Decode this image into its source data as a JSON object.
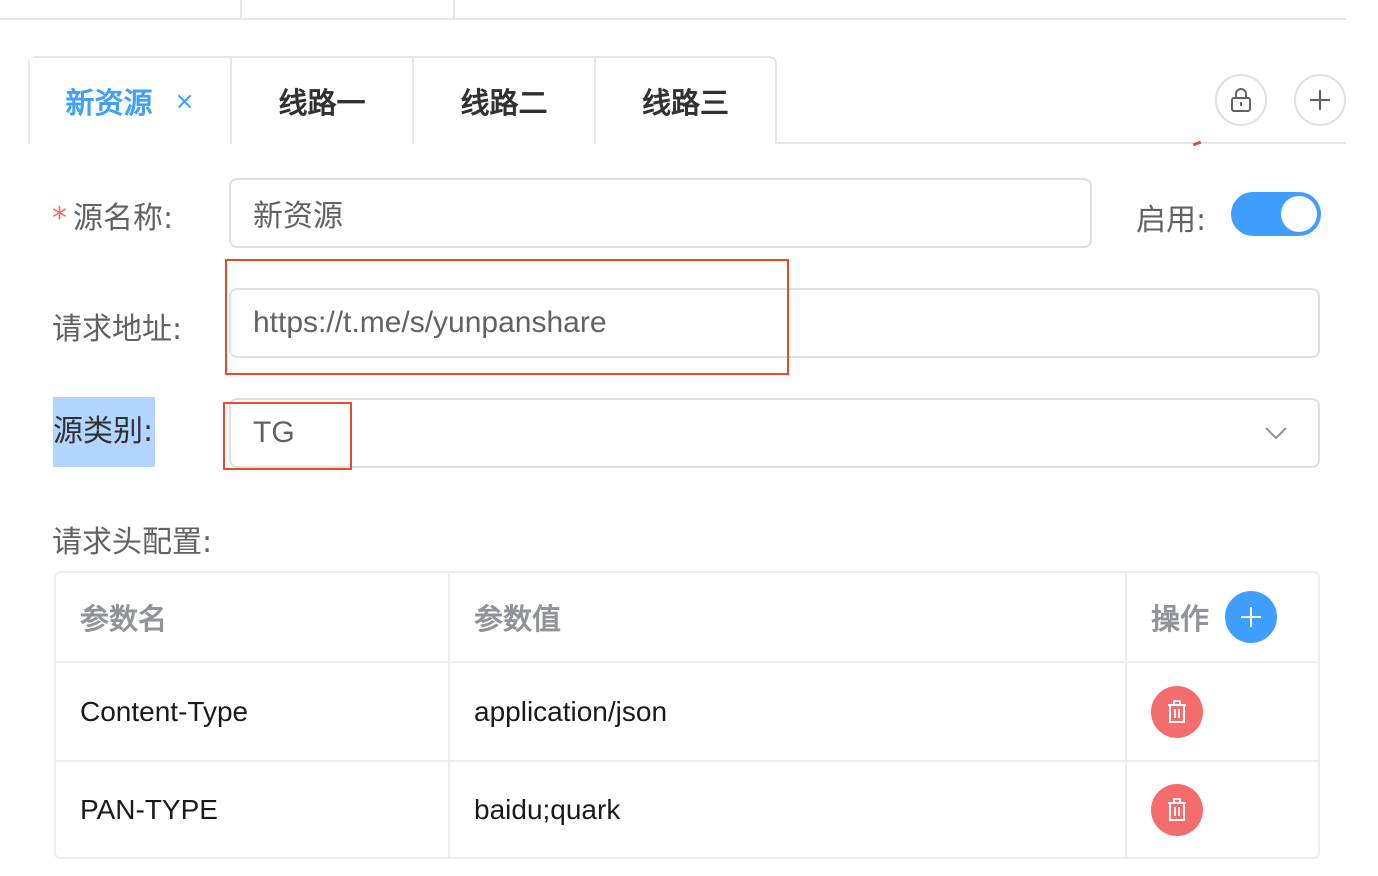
{
  "tabs": [
    {
      "label": "新资源",
      "active": true,
      "closable": true
    },
    {
      "label": "线路一",
      "active": false
    },
    {
      "label": "线路二",
      "active": false
    },
    {
      "label": "线路三",
      "active": false
    }
  ],
  "tab_close_glyph": "×",
  "tab_actions": {
    "lock_icon": "lock-icon",
    "add_icon": "plus-icon"
  },
  "form": {
    "name_label": "源名称:",
    "name_required_mark": "*",
    "name_value": "新资源",
    "enable_label": "启用:",
    "enabled": true,
    "url_label": "请求地址:",
    "url_value": "https://t.me/s/yunpanshare",
    "type_label": "源类别:",
    "type_value": "TG",
    "headers_label": "请求头配置:"
  },
  "headers_table": {
    "columns": [
      "参数名",
      "参数值",
      "操作"
    ],
    "rows": [
      {
        "name": "Content-Type",
        "value": "application/json"
      },
      {
        "name": "PAN-TYPE",
        "value": "baidu;quark"
      }
    ]
  },
  "colors": {
    "accent": "#409eff",
    "danger": "#f56c6c",
    "annotation": "#e84a2e"
  }
}
